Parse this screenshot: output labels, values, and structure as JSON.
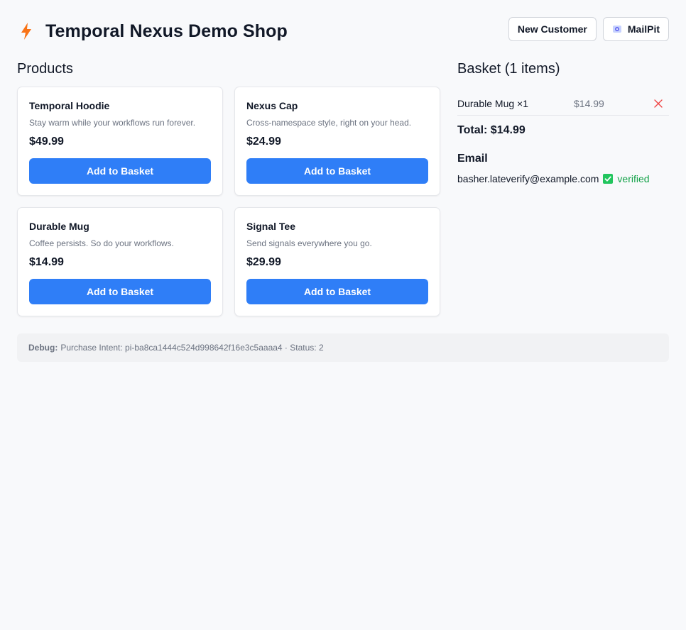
{
  "header": {
    "title": "Temporal Nexus Demo Shop",
    "brand_icon": "lightning-bolt-icon",
    "new_customer_label": "New Customer",
    "mailpit_label": "MailPit",
    "mailpit_icon": "mailpit-icon"
  },
  "colors": {
    "accent": "#2f7ef7",
    "bolt": "#f97316",
    "verified": "#16a34a",
    "remove": "#ef4444"
  },
  "products": {
    "heading": "Products",
    "add_label": "Add to Basket",
    "items": [
      {
        "name": "Temporal Hoodie",
        "description": "Stay warm while your workflows run forever.",
        "price": "$49.99"
      },
      {
        "name": "Nexus Cap",
        "description": "Cross-namespace style, right on your head.",
        "price": "$24.99"
      },
      {
        "name": "Durable Mug",
        "description": "Coffee persists. So do your workflows.",
        "price": "$14.99"
      },
      {
        "name": "Signal Tee",
        "description": "Send signals everywhere you go.",
        "price": "$29.99"
      }
    ]
  },
  "basket": {
    "heading": "Basket (1 items)",
    "items": [
      {
        "label": "Durable Mug ×1",
        "price": "$14.99"
      }
    ],
    "total": "Total: $14.99",
    "email_heading": "Email",
    "email": "basher.lateverify@example.com",
    "verified_label": "verified"
  },
  "debug": {
    "label": "Debug:",
    "text": "Purchase Intent: pi-ba8ca1444c524d998642f16e3c5aaaa4 · Status: 2"
  }
}
